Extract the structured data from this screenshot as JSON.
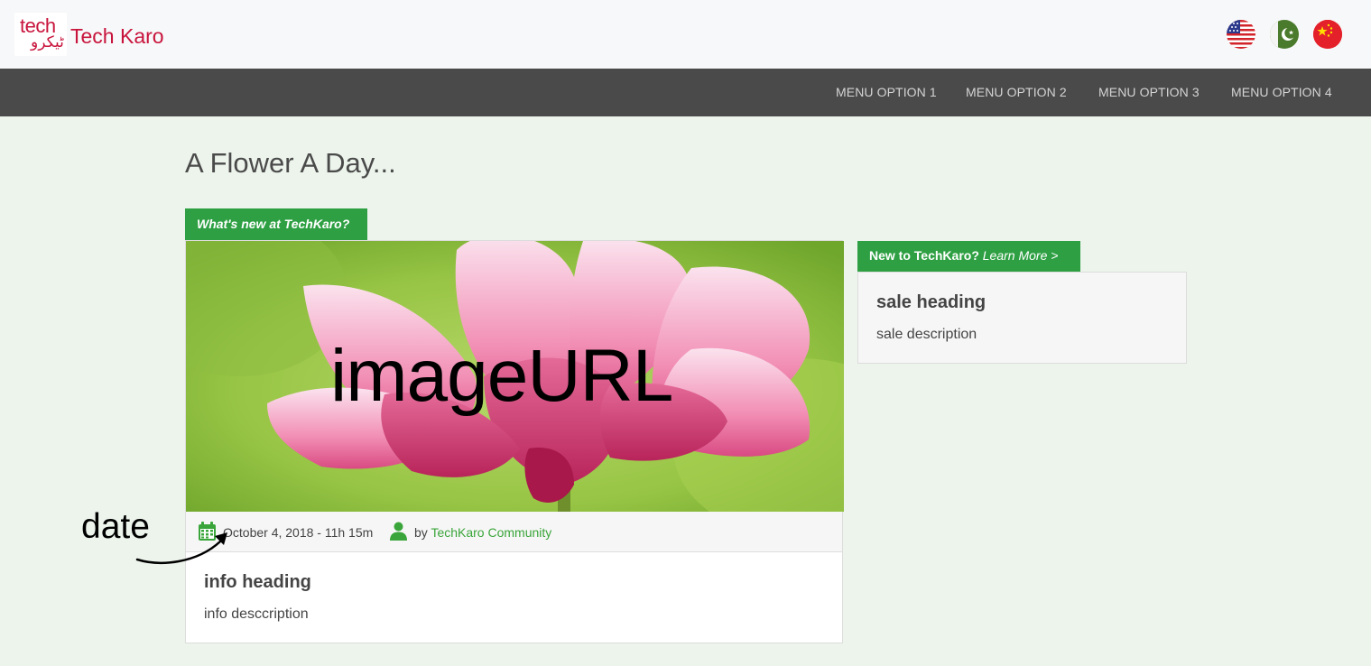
{
  "header": {
    "logo_tech": "tech",
    "logo_urdu": "ٹیکرو",
    "brand_name": "Tech Karo",
    "languages": [
      {
        "flag": "us-flag-icon",
        "label": "English"
      },
      {
        "flag": "pk-flag-icon",
        "label": "Urdu"
      },
      {
        "flag": "cn-flag-icon",
        "label": "Chinese"
      }
    ]
  },
  "nav": {
    "items": [
      "MENU OPTION 1",
      "MENU OPTION 2",
      "MENU OPTION 3",
      "MENU OPTION 4"
    ]
  },
  "main": {
    "page_title": "A Flower A Day...",
    "whats_new_tag": "What's new at TechKaro?",
    "post": {
      "image_label": "imageURL",
      "date": "October 4, 2018 - 11h 15m",
      "by_prefix": "by",
      "author": "TechKaro Community",
      "heading": "info heading",
      "description": "info desccription"
    },
    "sidebar": {
      "tag_prefix": "New to TechKaro?",
      "tag_link": "Learn More >",
      "sale_heading": "sale heading",
      "sale_description": "sale description"
    }
  },
  "annotation": {
    "label": "date"
  },
  "colors": {
    "brand": "#c8143c",
    "accent_green": "#2ea043",
    "nav_bg": "#4a4a4a",
    "page_bg": "#ecf4ec"
  }
}
